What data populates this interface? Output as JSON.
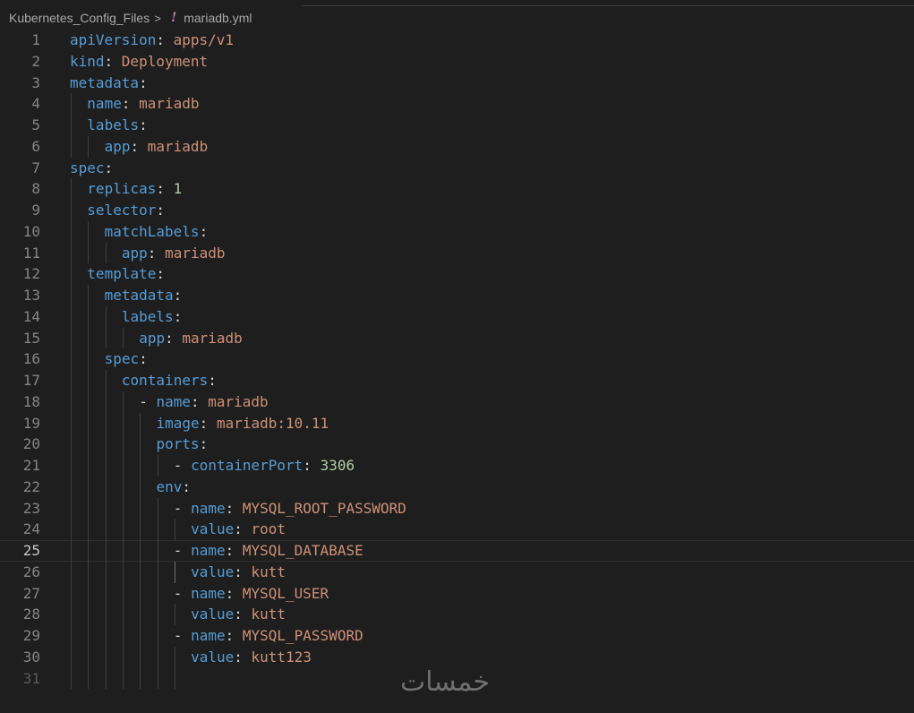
{
  "breadcrumb": {
    "folder": "Kubernetes_Config_Files",
    "separator": ">",
    "file_icon": "!",
    "file": "mariadb.yml"
  },
  "editor": {
    "current_line": 25,
    "lines": [
      {
        "n": "1",
        "indent": 0,
        "guides": 0,
        "key": "apiVersion",
        "value": "apps/v1",
        "type": "string",
        "dash": false
      },
      {
        "n": "2",
        "indent": 0,
        "guides": 0,
        "key": "kind",
        "value": "Deployment",
        "type": "string",
        "dash": false
      },
      {
        "n": "3",
        "indent": 0,
        "guides": 0,
        "key": "metadata",
        "value": "",
        "type": "none",
        "dash": false
      },
      {
        "n": "4",
        "indent": 2,
        "guides": 1,
        "key": "name",
        "value": "mariadb",
        "type": "string",
        "dash": false
      },
      {
        "n": "5",
        "indent": 2,
        "guides": 1,
        "key": "labels",
        "value": "",
        "type": "none",
        "dash": false
      },
      {
        "n": "6",
        "indent": 4,
        "guides": 2,
        "key": "app",
        "value": "mariadb",
        "type": "string",
        "dash": false
      },
      {
        "n": "7",
        "indent": 0,
        "guides": 0,
        "key": "spec",
        "value": "",
        "type": "none",
        "dash": false
      },
      {
        "n": "8",
        "indent": 2,
        "guides": 1,
        "key": "replicas",
        "value": "1",
        "type": "number",
        "dash": false
      },
      {
        "n": "9",
        "indent": 2,
        "guides": 1,
        "key": "selector",
        "value": "",
        "type": "none",
        "dash": false
      },
      {
        "n": "10",
        "indent": 4,
        "guides": 2,
        "key": "matchLabels",
        "value": "",
        "type": "none",
        "dash": false
      },
      {
        "n": "11",
        "indent": 6,
        "guides": 3,
        "key": "app",
        "value": "mariadb",
        "type": "string",
        "dash": false
      },
      {
        "n": "12",
        "indent": 2,
        "guides": 1,
        "key": "template",
        "value": "",
        "type": "none",
        "dash": false
      },
      {
        "n": "13",
        "indent": 4,
        "guides": 2,
        "key": "metadata",
        "value": "",
        "type": "none",
        "dash": false
      },
      {
        "n": "14",
        "indent": 6,
        "guides": 3,
        "key": "labels",
        "value": "",
        "type": "none",
        "dash": false
      },
      {
        "n": "15",
        "indent": 8,
        "guides": 4,
        "key": "app",
        "value": "mariadb",
        "type": "string",
        "dash": false
      },
      {
        "n": "16",
        "indent": 4,
        "guides": 2,
        "key": "spec",
        "value": "",
        "type": "none",
        "dash": false
      },
      {
        "n": "17",
        "indent": 6,
        "guides": 3,
        "key": "containers",
        "value": "",
        "type": "none",
        "dash": false
      },
      {
        "n": "18",
        "indent": 8,
        "guides": 4,
        "key": "name",
        "value": "mariadb",
        "type": "string",
        "dash": true
      },
      {
        "n": "19",
        "indent": 10,
        "guides": 5,
        "key": "image",
        "value": "mariadb:10.11",
        "type": "string",
        "dash": false
      },
      {
        "n": "20",
        "indent": 10,
        "guides": 5,
        "key": "ports",
        "value": "",
        "type": "none",
        "dash": false
      },
      {
        "n": "21",
        "indent": 12,
        "guides": 6,
        "key": "containerPort",
        "value": "3306",
        "type": "number",
        "dash": true
      },
      {
        "n": "22",
        "indent": 10,
        "guides": 5,
        "key": "env",
        "value": "",
        "type": "none",
        "dash": false
      },
      {
        "n": "23",
        "indent": 12,
        "guides": 6,
        "key": "name",
        "value": "MYSQL_ROOT_PASSWORD",
        "type": "string",
        "dash": true
      },
      {
        "n": "24",
        "indent": 14,
        "guides": 7,
        "key": "value",
        "value": "root",
        "type": "string",
        "dash": false
      },
      {
        "n": "25",
        "indent": 12,
        "guides": 6,
        "key": "name",
        "value": "MYSQL_DATABASE",
        "type": "string",
        "dash": true
      },
      {
        "n": "26",
        "indent": 14,
        "guides": 7,
        "key": "value",
        "value": "kutt",
        "type": "string",
        "dash": false
      },
      {
        "n": "27",
        "indent": 12,
        "guides": 6,
        "key": "name",
        "value": "MYSQL_USER",
        "type": "string",
        "dash": true
      },
      {
        "n": "28",
        "indent": 14,
        "guides": 7,
        "key": "value",
        "value": "kutt",
        "type": "string",
        "dash": false
      },
      {
        "n": "29",
        "indent": 12,
        "guides": 6,
        "key": "name",
        "value": "MYSQL_PASSWORD",
        "type": "string",
        "dash": true
      },
      {
        "n": "30",
        "indent": 14,
        "guides": 7,
        "key": "value",
        "value": "kutt123",
        "type": "string",
        "dash": false
      },
      {
        "n": "31",
        "indent": 0,
        "guides": 7,
        "key": "",
        "value": "",
        "type": "none",
        "dash": false
      }
    ]
  },
  "watermark": {
    "text": "خمسات"
  },
  "colors": {
    "background": "#1e1e1e",
    "key": "#569cd6",
    "string": "#ce9178",
    "number": "#b5cea8",
    "line_number": "#858585"
  }
}
